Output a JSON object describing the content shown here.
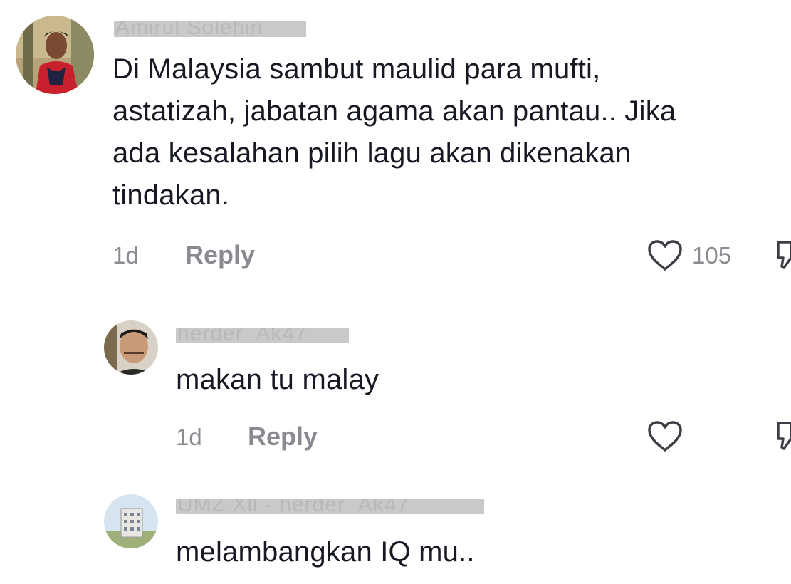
{
  "comments": [
    {
      "username": "Amirul Solehin",
      "text": "Di Malaysia sambut maulid para mufti,\nastatizah, jabatan agama akan pantau.. Jika\nada kesalahan pilih lagu akan dikenakan\ntindakan.",
      "time": "1d",
      "reply_label": "Reply",
      "likes": "105",
      "avatar": "profile-photo-man-red-shirt"
    },
    {
      "username": "herder_Ak47",
      "text": "makan tu malay",
      "time": "1d",
      "reply_label": "Reply",
      "likes": "",
      "avatar": "profile-photo-man-face"
    },
    {
      "username": "UMZ Xll - herder_Ak47",
      "text": "melambangkan IQ mu..",
      "avatar": "profile-photo-building"
    }
  ],
  "colors": {
    "text": "#161823",
    "secondary": "#8a8b91",
    "redaction": "#c9c9c9"
  }
}
